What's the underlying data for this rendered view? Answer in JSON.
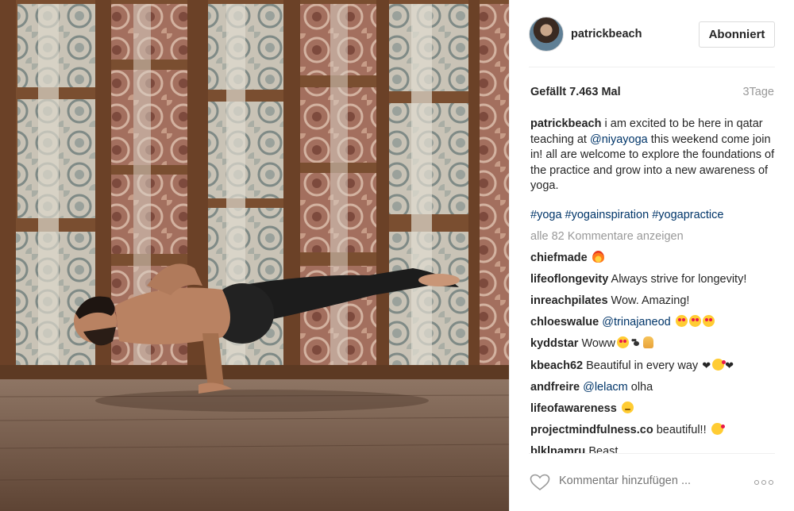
{
  "post": {
    "username": "patrickbeach",
    "follow_label": "Abonniert",
    "likes": "Gefällt 7.463 Mal",
    "time_ago": "3Tage",
    "caption": {
      "username": "patrickbeach",
      "text_before": "i am excited to be here in qatar teaching at",
      "mention": "@niyayoga",
      "text_after": "this weekend come join in! all are welcome to explore the foundations of the practice and grow into a new awareness of yoga."
    },
    "hashtags": [
      "#yoga",
      "#yogainspiration",
      "#yogapractice"
    ],
    "view_all": "alle 82 Kommentare anzeigen",
    "comments": [
      {
        "user": "chiefmade",
        "text": "",
        "emoji": "fire"
      },
      {
        "user": "lifeoflongevity",
        "text": "Always strive for longevity!"
      },
      {
        "user": "inreachpilates",
        "text": "Wow. Amazing!"
      },
      {
        "user": "chloeswalue",
        "mention": "@trinajaneod",
        "emoji": "heart-eyes x3"
      },
      {
        "user": "kyddstar",
        "text": "Woww",
        "emoji": "heart-eyes paw pray"
      },
      {
        "user": "kbeach62",
        "text": "Beautiful in every way",
        "emoji": "heart kiss heart"
      },
      {
        "user": "andfreire",
        "mention": "@lelacm",
        "text": "olha"
      },
      {
        "user": "lifeofawareness",
        "text": "",
        "emoji": "wink"
      },
      {
        "user": "projectmindfulness.co",
        "text": "beautiful!!",
        "emoji": "kiss"
      },
      {
        "user": "blklnamru",
        "text": "Beast"
      }
    ],
    "add_comment_placeholder": "Kommentar hinzufügen ...",
    "icons": [
      "heart-outline-icon",
      "more-options-icon"
    ],
    "colors": {
      "link": "#003569",
      "muted": "#999999",
      "text": "#262626"
    }
  }
}
